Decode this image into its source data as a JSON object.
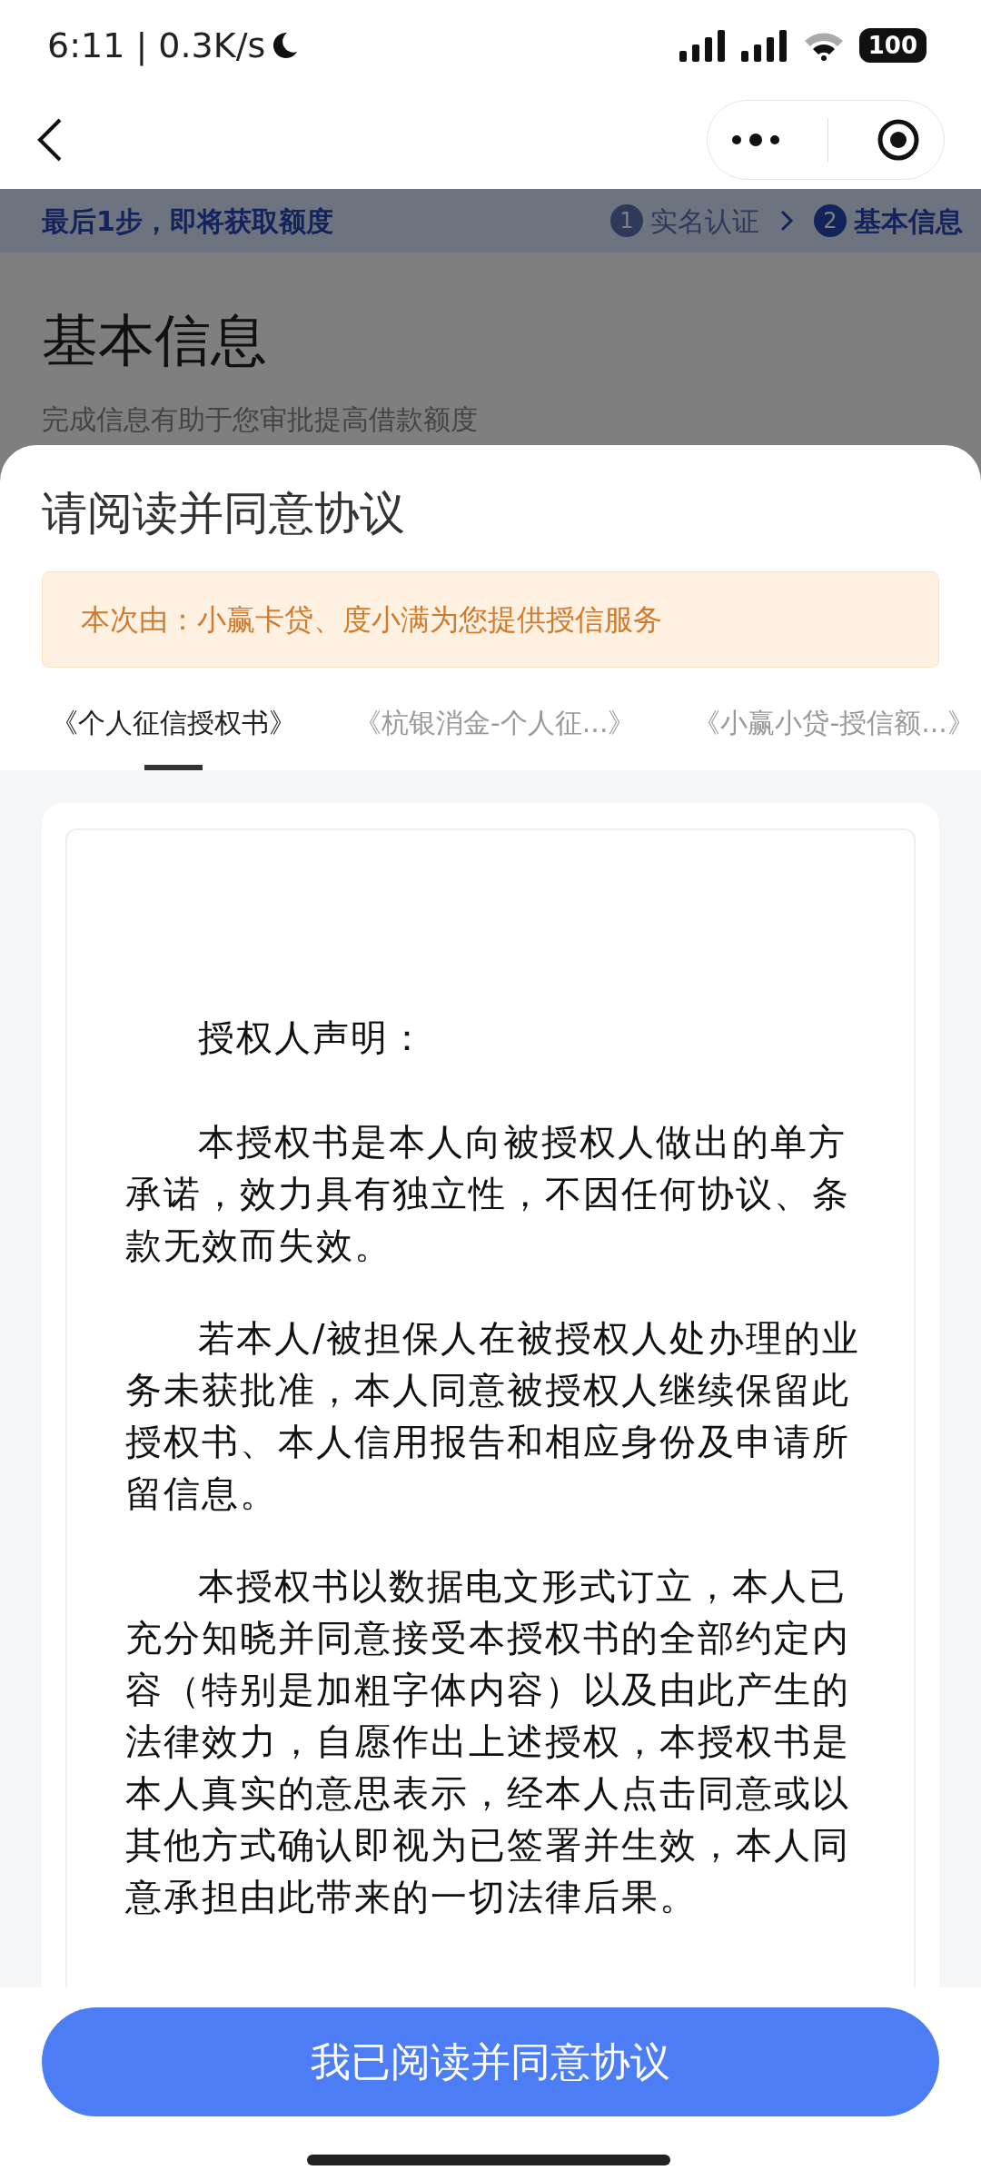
{
  "status_bar": {
    "time": "6:11 | 0.3K/s",
    "battery": "100"
  },
  "progress_banner": {
    "message": "最后1步，即将获取额度",
    "steps": [
      {
        "number": "1",
        "label": "实名认证",
        "selected": false
      },
      {
        "number": "2",
        "label": "基本信息",
        "selected": true
      }
    ]
  },
  "page": {
    "title": "基本信息",
    "subtitle": "完成信息有助于您审批提高借款额度"
  },
  "sheet": {
    "title": "请阅读并同意协议",
    "notice": "本次由：小赢卡贷、度小满为您提供授信服务",
    "tabs": [
      {
        "label": "《个人征信授权书》",
        "selected": true
      },
      {
        "label": "《杭银消金-个人征...》",
        "selected": false
      },
      {
        "label": "《小赢小贷-授信额...》",
        "selected": false
      }
    ],
    "document": {
      "heading": "授权人声明：",
      "paragraphs": [
        "本授权书是本人向被授权人做出的单方承诺，效力具有独立性，不因任何协议、条款无效而失效。",
        "若本人/被担保人在被授权人处办理的业务未获批准，本人同意被授权人继续保留此授权书、本人信用报告和相应身份及申请所留信息。",
        "本授权书以数据电文形式订立，本人已充分知晓并同意接受本授权书的全部约定内容（特别是加粗字体内容）以及由此产生的法律效力，自愿作出上述授权，本授权书是本人真实的意思表示，经本人点击同意或以其他方式确认即视为已签署并生效，本人同意承担由此带来的一切法律后果。"
      ]
    },
    "agree_button": "我已阅读并同意协议"
  }
}
